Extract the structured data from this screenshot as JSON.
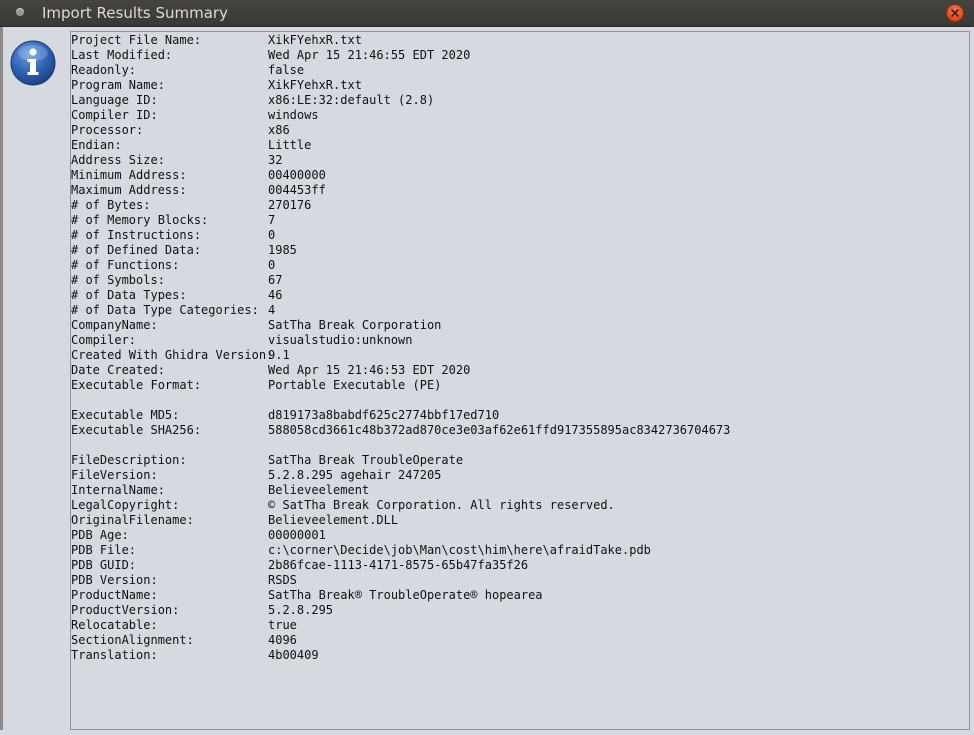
{
  "window": {
    "title": "Import Results Summary"
  },
  "icons": {
    "dialog_icon": "info-icon",
    "close_icon": "close-icon",
    "window_menu_icon": "window-menu-icon"
  },
  "colors": {
    "titlebar": "#3c3b37",
    "close_button": "#df4a1b",
    "info_icon_blue": "#2f63b5",
    "panel_background": "#d6d9df"
  },
  "summary": {
    "rows": [
      {
        "key": "Project File Name:",
        "value": "XikFYehxR.txt"
      },
      {
        "key": "Last Modified:",
        "value": "Wed Apr 15 21:46:55 EDT 2020"
      },
      {
        "key": "Readonly:",
        "value": "false"
      },
      {
        "key": "Program Name:",
        "value": "XikFYehxR.txt"
      },
      {
        "key": "Language ID:",
        "value": "x86:LE:32:default (2.8)"
      },
      {
        "key": "Compiler ID:",
        "value": "windows"
      },
      {
        "key": "Processor:",
        "value": "x86"
      },
      {
        "key": "Endian:",
        "value": "Little"
      },
      {
        "key": "Address Size:",
        "value": "32"
      },
      {
        "key": "Minimum Address:",
        "value": "00400000"
      },
      {
        "key": "Maximum Address:",
        "value": "004453ff"
      },
      {
        "key": "# of Bytes:",
        "value": "270176"
      },
      {
        "key": "# of Memory Blocks:",
        "value": "7"
      },
      {
        "key": "# of Instructions:",
        "value": "0"
      },
      {
        "key": "# of Defined Data:",
        "value": "1985"
      },
      {
        "key": "# of Functions:",
        "value": "0"
      },
      {
        "key": "# of Symbols:",
        "value": "67"
      },
      {
        "key": "# of Data Types:",
        "value": "46"
      },
      {
        "key": "# of Data Type Categories:",
        "value": "4"
      },
      {
        "key": "CompanyName:",
        "value": "SatTha Break Corporation"
      },
      {
        "key": "Compiler:",
        "value": "visualstudio:unknown"
      },
      {
        "key": "Created With Ghidra Version:",
        "value": "9.1"
      },
      {
        "key": "Date Created:",
        "value": "Wed Apr 15 21:46:53 EDT 2020"
      },
      {
        "key": "Executable Format:",
        "value": "Portable Executable (PE)"
      },
      {
        "key": "",
        "value": ""
      },
      {
        "key": "Executable MD5:",
        "value": "d819173a8babdf625c2774bbf17ed710"
      },
      {
        "key": "Executable SHA256:",
        "value": "588058cd3661c48b372ad870ce3e03af62e61ffd917355895ac8342736704673"
      },
      {
        "key": "",
        "value": ""
      },
      {
        "key": "FileDescription:",
        "value": "SatTha Break TroubleOperate"
      },
      {
        "key": "FileVersion:",
        "value": "5.2.8.295 agehair 247205"
      },
      {
        "key": "InternalName:",
        "value": "Believeelement"
      },
      {
        "key": "LegalCopyright:",
        "value": "© SatTha Break Corporation. All rights reserved."
      },
      {
        "key": "OriginalFilename:",
        "value": "Believeelement.DLL"
      },
      {
        "key": "PDB Age:",
        "value": "00000001"
      },
      {
        "key": "PDB File:",
        "value": "c:\\corner\\Decide\\job\\Man\\cost\\him\\here\\afraidTake.pdb"
      },
      {
        "key": "PDB GUID:",
        "value": "2b86fcae-1113-4171-8575-65b47fa35f26"
      },
      {
        "key": "PDB Version:",
        "value": "RSDS"
      },
      {
        "key": "ProductName:",
        "value": "SatTha Break® TroubleOperate® hopearea"
      },
      {
        "key": "ProductVersion:",
        "value": "5.2.8.295"
      },
      {
        "key": "Relocatable:",
        "value": "true"
      },
      {
        "key": "SectionAlignment:",
        "value": "4096"
      },
      {
        "key": "Translation:",
        "value": "4b00409"
      }
    ]
  }
}
